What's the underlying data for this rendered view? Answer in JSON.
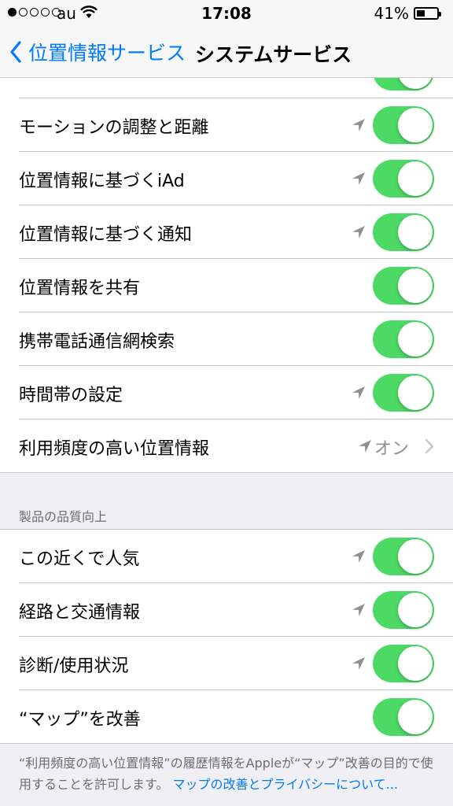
{
  "status_bar": {
    "carrier": "au",
    "time": "17:08",
    "battery_percent": "41%",
    "battery_level": 0.41,
    "signal_bars": 1,
    "signal_total": 5
  },
  "nav": {
    "back_label": "位置情報サービス",
    "title": "システムサービス"
  },
  "system_services": [
    {
      "label": "モーションの調整と距離",
      "location_arrow": true,
      "toggle": "on"
    },
    {
      "label": "位置情報に基づくiAd",
      "location_arrow": true,
      "toggle": "on"
    },
    {
      "label": "位置情報に基づく通知",
      "location_arrow": true,
      "toggle": "on"
    },
    {
      "label": "位置情報を共有",
      "location_arrow": false,
      "toggle": "on"
    },
    {
      "label": "携帯電話通信網検索",
      "location_arrow": false,
      "toggle": "on"
    },
    {
      "label": "時間帯の設定",
      "location_arrow": true,
      "toggle": "on"
    }
  ],
  "frequent_locations": {
    "label": "利用頻度の高い位置情報",
    "value": "オン"
  },
  "improvement_section": {
    "header": "製品の品質向上",
    "items": [
      {
        "label": "この近くで人気",
        "location_arrow": true,
        "toggle": "on"
      },
      {
        "label": "経路と交通情報",
        "location_arrow": true,
        "toggle": "on"
      },
      {
        "label": "診断/使用状況",
        "location_arrow": true,
        "toggle": "on"
      },
      {
        "label": "“マップ”を改善",
        "location_arrow": false,
        "toggle": "on"
      }
    ]
  },
  "footer": {
    "text": "“利用頻度の高い位置情報”の履歴情報をAppleが“マップ”改善の目的で使用することを許可します。",
    "link": "マップの改善とプライバシーについて..."
  },
  "colors": {
    "accent": "#007aff",
    "switch_on": "#4cd964",
    "location_arrow": "#8e8e93"
  }
}
